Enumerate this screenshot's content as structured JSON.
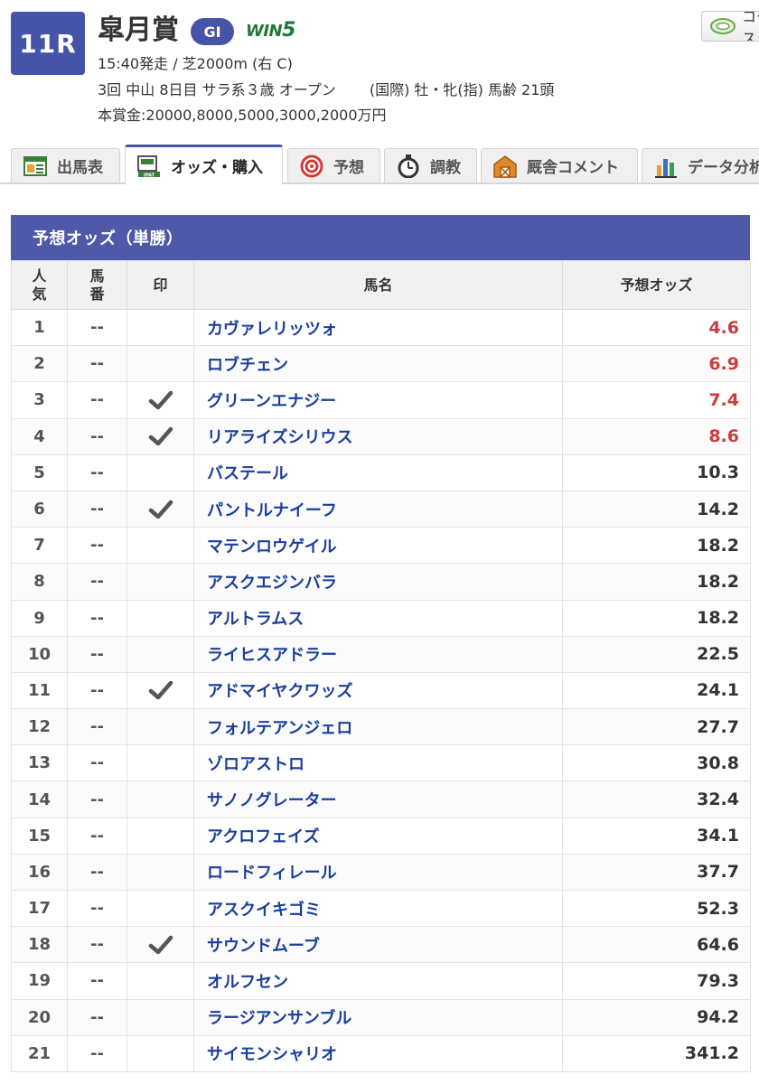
{
  "race": {
    "number": "11R",
    "name": "皐月賞",
    "grade": "GI",
    "win5_win": "WIN",
    "win5_num": "5",
    "info_line1": "15:40発走 / 芝2000m (右 C)",
    "info_line2": "3回 中山 8日目 サラ系３歳 オープン　　 (国際) 牡・牝(指) 馬齢 21頭",
    "prize": "本賞金:20000,8000,5000,3000,2000万円",
    "course_button": "コース"
  },
  "tabs": [
    {
      "label": "出馬表",
      "icon": "table-icon",
      "active": false
    },
    {
      "label": "オッズ・購入",
      "icon": "ipat-icon",
      "active": true
    },
    {
      "label": "予想",
      "icon": "target-icon",
      "active": false
    },
    {
      "label": "調教",
      "icon": "stopwatch-icon",
      "active": false
    },
    {
      "label": "厩舎コメント",
      "icon": "barn-icon",
      "active": false
    },
    {
      "label": "データ分析",
      "icon": "bar-chart-icon",
      "active": false
    }
  ],
  "odds_table": {
    "title": "予想オッズ（単勝）",
    "headers": {
      "rank_1": "人",
      "rank_2": "気",
      "num_1": "馬",
      "num_2": "番",
      "mark": "印",
      "name": "馬名",
      "odds": "予想オッズ"
    },
    "rows": [
      {
        "rank": "1",
        "num": "--",
        "mark": false,
        "name": "カヴァレリッツォ",
        "odds": "4.6",
        "hot": true
      },
      {
        "rank": "2",
        "num": "--",
        "mark": false,
        "name": "ロブチェン",
        "odds": "6.9",
        "hot": true
      },
      {
        "rank": "3",
        "num": "--",
        "mark": true,
        "name": "グリーンエナジー",
        "odds": "7.4",
        "hot": true
      },
      {
        "rank": "4",
        "num": "--",
        "mark": true,
        "name": "リアライズシリウス",
        "odds": "8.6",
        "hot": true
      },
      {
        "rank": "5",
        "num": "--",
        "mark": false,
        "name": "バステール",
        "odds": "10.3",
        "hot": false
      },
      {
        "rank": "6",
        "num": "--",
        "mark": true,
        "name": "パントルナイーフ",
        "odds": "14.2",
        "hot": false
      },
      {
        "rank": "7",
        "num": "--",
        "mark": false,
        "name": "マテンロウゲイル",
        "odds": "18.2",
        "hot": false
      },
      {
        "rank": "8",
        "num": "--",
        "mark": false,
        "name": "アスクエジンバラ",
        "odds": "18.2",
        "hot": false
      },
      {
        "rank": "9",
        "num": "--",
        "mark": false,
        "name": "アルトラムス",
        "odds": "18.2",
        "hot": false
      },
      {
        "rank": "10",
        "num": "--",
        "mark": false,
        "name": "ライヒスアドラー",
        "odds": "22.5",
        "hot": false
      },
      {
        "rank": "11",
        "num": "--",
        "mark": true,
        "name": "アドマイヤクワッズ",
        "odds": "24.1",
        "hot": false
      },
      {
        "rank": "12",
        "num": "--",
        "mark": false,
        "name": "フォルテアンジェロ",
        "odds": "27.7",
        "hot": false
      },
      {
        "rank": "13",
        "num": "--",
        "mark": false,
        "name": "ゾロアストロ",
        "odds": "30.8",
        "hot": false
      },
      {
        "rank": "14",
        "num": "--",
        "mark": false,
        "name": "サノノグレーター",
        "odds": "32.4",
        "hot": false
      },
      {
        "rank": "15",
        "num": "--",
        "mark": false,
        "name": "アクロフェイズ",
        "odds": "34.1",
        "hot": false
      },
      {
        "rank": "16",
        "num": "--",
        "mark": false,
        "name": "ロードフィレール",
        "odds": "37.7",
        "hot": false
      },
      {
        "rank": "17",
        "num": "--",
        "mark": false,
        "name": "アスクイキゴミ",
        "odds": "52.3",
        "hot": false
      },
      {
        "rank": "18",
        "num": "--",
        "mark": true,
        "name": "サウンドムーブ",
        "odds": "64.6",
        "hot": false
      },
      {
        "rank": "19",
        "num": "--",
        "mark": false,
        "name": "オルフセン",
        "odds": "79.3",
        "hot": false
      },
      {
        "rank": "20",
        "num": "--",
        "mark": false,
        "name": "ラージアンサンブル",
        "odds": "94.2",
        "hot": false
      },
      {
        "rank": "21",
        "num": "--",
        "mark": false,
        "name": "サイモンシャリオ",
        "odds": "341.2",
        "hot": false
      }
    ]
  },
  "colors": {
    "accent": "#4654a8",
    "hot_odds": "#cc3c3c",
    "horse_link": "#1b3e9c",
    "win5": "#1f7a3a"
  }
}
